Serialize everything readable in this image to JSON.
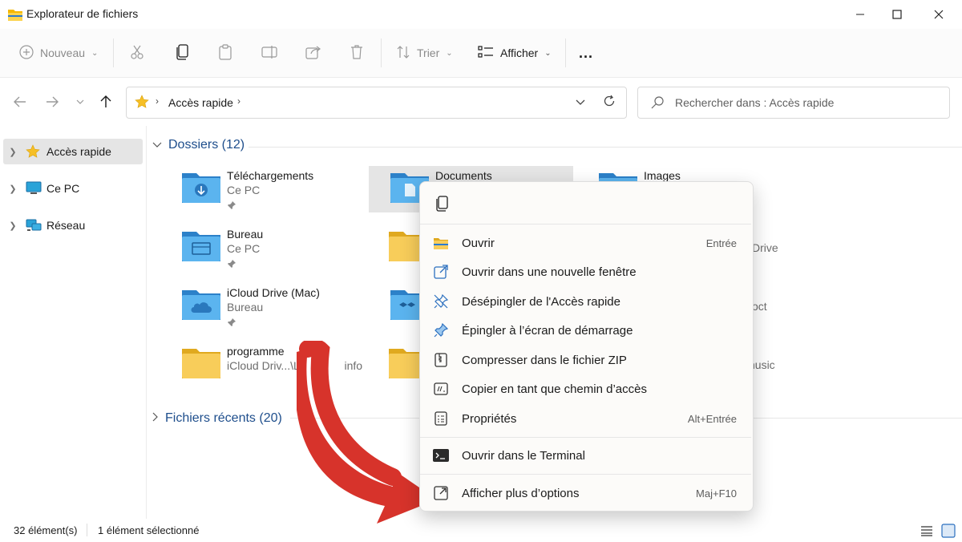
{
  "window": {
    "title": "Explorateur de fichiers"
  },
  "toolbar": {
    "new_label": "Nouveau",
    "sort_label": "Trier",
    "view_label": "Afficher",
    "more_label": "..."
  },
  "address": {
    "location": "Accès rapide",
    "search_placeholder": "Rechercher dans : Accès rapide"
  },
  "sidebar": {
    "items": [
      {
        "label": "Accès rapide",
        "icon": "star-icon"
      },
      {
        "label": "Ce PC",
        "icon": "monitor-icon"
      },
      {
        "label": "Réseau",
        "icon": "network-icon"
      }
    ]
  },
  "main": {
    "folders_header": "Dossiers (12)",
    "recent_header": "Fichiers récents (20)",
    "folders": [
      {
        "name": "Téléchargements",
        "location": "Ce PC",
        "icon": "download-folder-icon"
      },
      {
        "name": "Documents",
        "location": "",
        "icon": "documents-folder-icon"
      },
      {
        "name": "Images",
        "location": "",
        "icon": "images-folder-icon"
      },
      {
        "name": "Bureau",
        "location": "Ce PC",
        "icon": "desktop-folder-icon"
      },
      {
        "name": "iCloud Drive (Mac)",
        "location": "Bureau",
        "icon": "icloud-folder-icon"
      },
      {
        "name": "programme",
        "location": "iCloud Driv...\\Le ",
        "icon": "folder-icon"
      }
    ],
    "partial_texts": [
      "info",
      "Drive",
      "oct",
      "nusic"
    ]
  },
  "context_menu": {
    "items": [
      {
        "label": "Ouvrir",
        "shortcut": "Entrée",
        "icon": "open-folder-icon"
      },
      {
        "label": "Ouvrir dans une nouvelle fenêtre",
        "shortcut": "",
        "icon": "new-window-icon"
      },
      {
        "label": "Désépingler de l'Accès rapide",
        "shortcut": "",
        "icon": "unpin-icon"
      },
      {
        "label": "Épingler à l’écran de démarrage",
        "shortcut": "",
        "icon": "pin-icon"
      },
      {
        "label": "Compresser dans le fichier ZIP",
        "shortcut": "",
        "icon": "zip-icon"
      },
      {
        "label": "Copier en tant que chemin d’accès",
        "shortcut": "",
        "icon": "copy-path-icon"
      },
      {
        "label": "Propriétés",
        "shortcut": "Alt+Entrée",
        "icon": "properties-icon"
      },
      {
        "label": "Ouvrir dans le Terminal",
        "shortcut": "",
        "icon": "terminal-icon"
      },
      {
        "label": "Afficher plus d’options",
        "shortcut": "Maj+F10",
        "icon": "more-options-icon"
      }
    ]
  },
  "status": {
    "count": "32 élément(s)",
    "selected": "1 élément sélectionné"
  },
  "colors": {
    "accent": "#1e4e8c",
    "folder_yellow": "#f8c440",
    "folder_blue": "#3a8fd6",
    "arrow_red": "#d7332b"
  }
}
